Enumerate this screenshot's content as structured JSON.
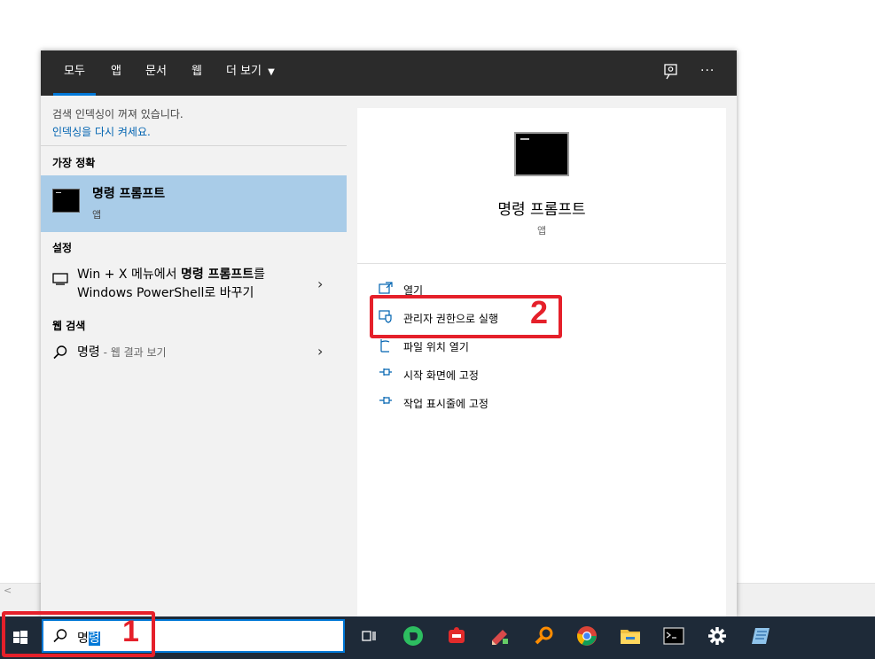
{
  "tabs": [
    {
      "label": "모두"
    },
    {
      "label": "앱"
    },
    {
      "label": "문서"
    },
    {
      "label": "웹"
    },
    {
      "label": "더 보기"
    }
  ],
  "toolbar": {
    "feedback_icon": "feedback-icon",
    "more_icon": "more-options-icon",
    "more_label": "···"
  },
  "notice": {
    "text": "검색 인덱싱이 꺼져 있습니다.",
    "link": "인덱싱을 다시 켜세요."
  },
  "sections": {
    "best_match": "가장 정확",
    "settings": "설정",
    "web_search": "웹 검색"
  },
  "best_match": {
    "title": "명령 프롬프트",
    "subtitle": "앱"
  },
  "settings_item": {
    "line1_prefix": "Win + X 메뉴에서 ",
    "line1_bold": "명령 프롬프트",
    "line1_suffix": "를",
    "line2": "Windows PowerShell로 바꾸기"
  },
  "web_item": {
    "query": "명령",
    "suffix": " - 웹 결과 보기"
  },
  "preview": {
    "title": "명령 프롬프트",
    "subtitle": "앱"
  },
  "actions": [
    {
      "label": "열기",
      "icon": "open-icon"
    },
    {
      "label": "관리자 권한으로 실행",
      "icon": "shield-icon"
    },
    {
      "label": "파일 위치 열기",
      "icon": "file-location-icon"
    },
    {
      "label": "시작 화면에 고정",
      "icon": "pin-icon"
    },
    {
      "label": "작업 표시줄에 고정",
      "icon": "pin-icon"
    }
  ],
  "annotations": {
    "step1": "1",
    "step2": "2",
    "color": "#e5202a"
  },
  "taskbar": {
    "search_text_plain": "명",
    "search_text_selected": "령",
    "apps": [
      "task-view-icon",
      "evernote-icon",
      "pdf-tool-icon",
      "pen-tool-icon",
      "search-tool-icon",
      "chrome-icon",
      "file-explorer-icon",
      "cmd-icon",
      "settings-icon",
      "notepad-icon"
    ]
  },
  "colors": {
    "accent": "#0078d7",
    "selection": "#a9cce8",
    "topbar": "#2b2b2b",
    "taskbar": "#1e2a38"
  }
}
